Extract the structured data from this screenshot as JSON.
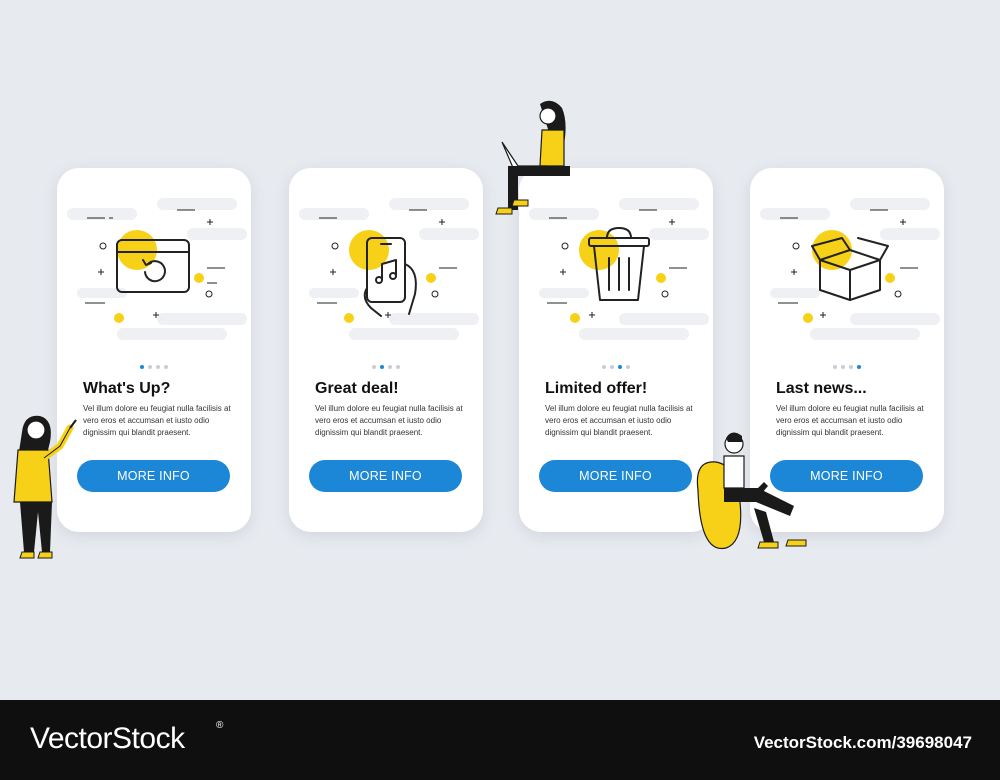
{
  "colors": {
    "background": "#e7eaef",
    "card": "#ffffff",
    "accent_blue": "#1b87d6",
    "accent_yellow": "#f7d117",
    "footer": "#0f0f0f"
  },
  "cards": [
    {
      "icon": "browser-refresh-icon",
      "active_dot": 0,
      "title": "What's Up?",
      "body": "Vel illum dolore eu feugiat nulla facilisis at vero eros et accumsan et iusto odio dignissim qui blandit praesent.",
      "button_label": "MORE INFO"
    },
    {
      "icon": "phone-music-icon",
      "active_dot": 1,
      "title": "Great deal!",
      "body": "Vel illum dolore eu feugiat nulla facilisis at vero eros et accumsan et iusto odio dignissim qui blandit praesent.",
      "button_label": "MORE INFO"
    },
    {
      "icon": "trash-bin-icon",
      "active_dot": 2,
      "title": "Limited offer!",
      "body": "Vel illum dolore eu feugiat nulla facilisis at vero eros et accumsan et iusto odio dignissim qui blandit praesent.",
      "button_label": "MORE INFO"
    },
    {
      "icon": "open-box-icon",
      "active_dot": 3,
      "title": "Last news...",
      "body": "Vel illum dolore eu feugiat nulla facilisis at vero eros et accumsan et iusto odio dignissim qui blandit praesent.",
      "button_label": "MORE INFO"
    }
  ],
  "footer": {
    "brand": "VectorStock",
    "registered_mark": "®",
    "stock_id": "VectorStock.com/39698047"
  }
}
